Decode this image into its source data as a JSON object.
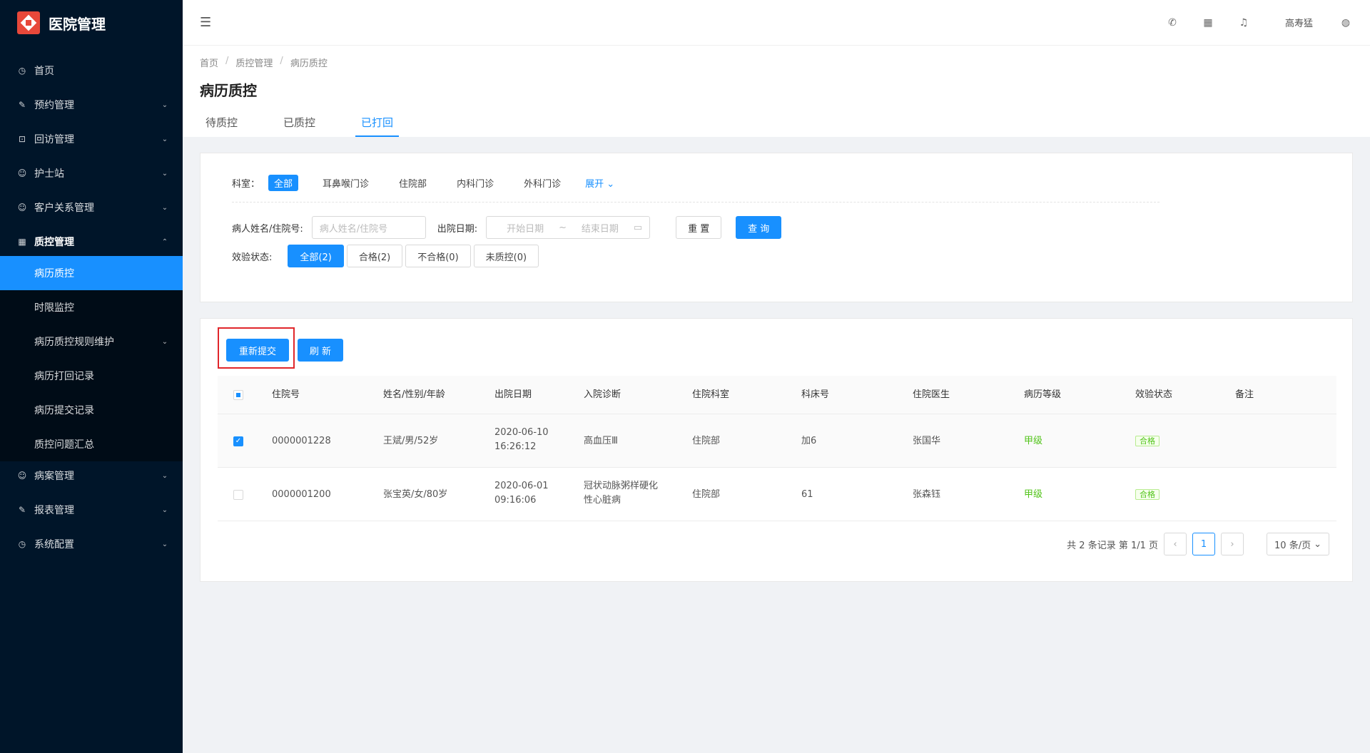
{
  "app": {
    "title": "医院管理"
  },
  "sidebar": {
    "items": [
      {
        "label": "首页",
        "icon": "dashboard-icon"
      },
      {
        "label": "预约管理",
        "icon": "edit-icon"
      },
      {
        "label": "回访管理",
        "icon": "lock-icon"
      },
      {
        "label": "护士站",
        "icon": "user-icon"
      },
      {
        "label": "客户关系管理",
        "icon": "user-icon"
      },
      {
        "label": "质控管理",
        "icon": "table-icon"
      }
    ],
    "sub_items": [
      "病历质控",
      "时限监控",
      "病历质控规则维护",
      "病历打回记录",
      "病历提交记录",
      "质控问题汇总"
    ],
    "after_items": [
      {
        "label": "病案管理",
        "icon": "user-icon"
      },
      {
        "label": "报表管理",
        "icon": "edit-icon"
      },
      {
        "label": "系统配置",
        "icon": "dashboard-icon"
      }
    ]
  },
  "header": {
    "username": "高寿猛"
  },
  "breadcrumb": [
    "首页",
    "质控管理",
    "病历质控"
  ],
  "page_title": "病历质控",
  "tabs": [
    "待质控",
    "已质控",
    "已打回"
  ],
  "filter": {
    "dept_label": "科室：",
    "depts": [
      "全部",
      "耳鼻喉门诊",
      "住院部",
      "内科门诊",
      "外科门诊"
    ],
    "expand": "展开",
    "name_label": "病人姓名/住院号:",
    "name_placeholder": "病人姓名/住院号",
    "date_label": "出院日期:",
    "date_start": "开始日期",
    "date_sep": "~",
    "date_end": "结束日期",
    "reset": "重 置",
    "query": "查 询",
    "status_label": "效验状态:",
    "statuses": [
      "全部(2)",
      "合格(2)",
      "不合格(0)",
      "未质控(0)"
    ]
  },
  "actions": {
    "resubmit": "重新提交",
    "refresh": "刷 新"
  },
  "table": {
    "columns": [
      "住院号",
      "姓名/性别/年龄",
      "出院日期",
      "入院诊断",
      "住院科室",
      "科床号",
      "住院医生",
      "病历等级",
      "效验状态",
      "备注"
    ],
    "rows": [
      {
        "checked": true,
        "id": "0000001228",
        "name": "王斌/男/52岁",
        "date1": "2020-06-10",
        "date2": "16:26:12",
        "diag1": "高血压Ⅲ",
        "diag2": "",
        "dept": "住院部",
        "bed": "加6",
        "doctor": "张国华",
        "level": "甲级",
        "status": "合格",
        "note": ""
      },
      {
        "checked": false,
        "id": "0000001200",
        "name": "张宝英/女/80岁",
        "date1": "2020-06-01",
        "date2": "09:16:06",
        "diag1": "冠状动脉粥样硬化",
        "diag2": "性心脏病",
        "dept": "住院部",
        "bed": "61",
        "doctor": "张森钰",
        "level": "甲级",
        "status": "合格",
        "note": ""
      }
    ]
  },
  "pagination": {
    "summary": "共 2 条记录 第 1/1 页",
    "current": "1",
    "page_size": "10 条/页"
  },
  "colors": {
    "primary": "#1890ff",
    "sidebar": "#001529",
    "success": "#52c41a",
    "highlight": "#e0262b"
  }
}
